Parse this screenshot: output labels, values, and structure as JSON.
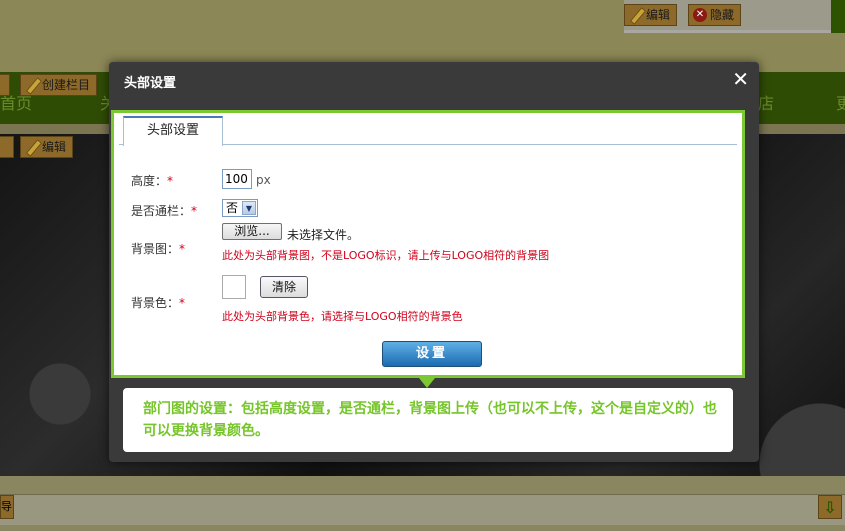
{
  "background": {
    "top_buttons": [
      {
        "label": "编辑",
        "icon": "pencil-icon"
      },
      {
        "label": "隐藏",
        "icon": "close-circle-icon"
      }
    ],
    "create_column_label": "创建栏目",
    "edit_label": "编辑",
    "nav_items": [
      "首页",
      "关",
      "店",
      "更"
    ],
    "bottom_button_label": "导"
  },
  "dialog": {
    "title": "头部设置",
    "close": "✕",
    "tab_label": "头部设置",
    "fields": {
      "height_label": "高度：",
      "height_value": "100",
      "height_unit": "px",
      "fullwidth_label": "是否通栏：",
      "fullwidth_value": "否",
      "bgimage_label": "背景图：",
      "browse_label": "浏览...",
      "no_file_text": "未选择文件。",
      "bgimage_hint": "此处为头部背景图，不是LOGO标识，请上传与LOGO相符的背景图",
      "bgcolor_label": "背景色：",
      "clear_label": "清除",
      "bgcolor_hint": "此处为头部背景色，请选择与LOGO相符的背景色"
    },
    "required_mark": "*",
    "submit_label": "设置"
  },
  "callout": {
    "text": "部门图的设置：包括高度设置，是否通栏，背景图上传（也可以不上传，这个是自定义的）也可以更换背景颜色。"
  },
  "colors": {
    "accent_green": "#7cc832",
    "hint_red": "#d0021b",
    "button_blue": "#1a6cb0"
  }
}
